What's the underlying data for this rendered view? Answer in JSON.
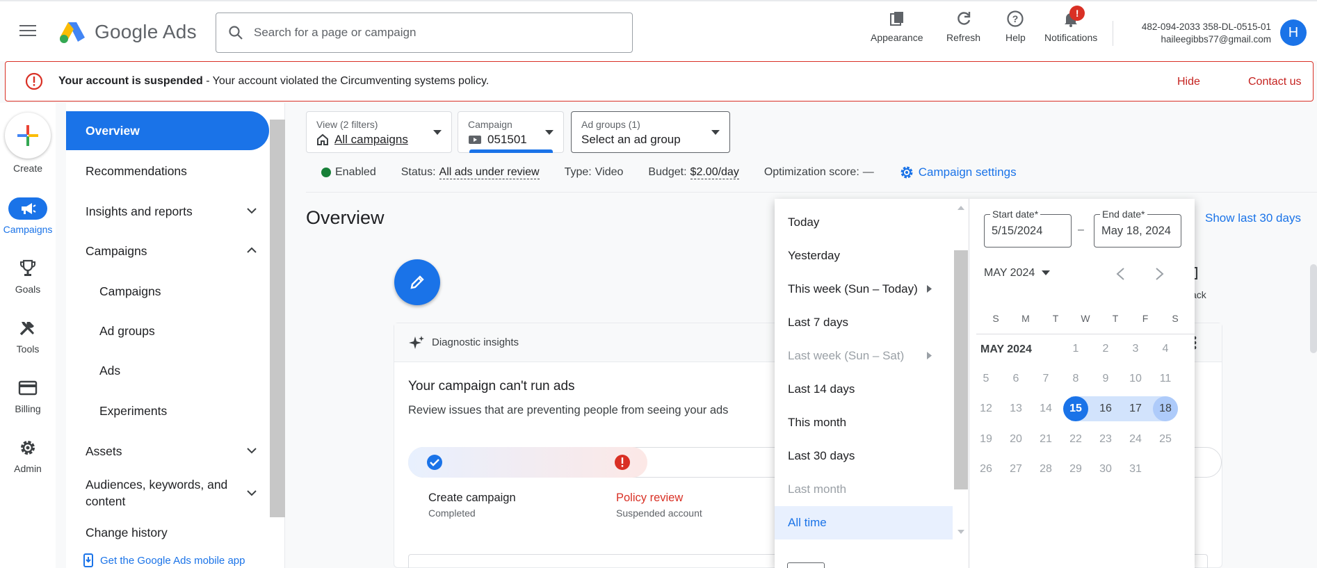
{
  "header": {
    "logo_text": "Google Ads",
    "search_placeholder": "Search for a page or campaign",
    "tools": [
      {
        "label": "Appearance",
        "icon": "appearance-icon"
      },
      {
        "label": "Refresh",
        "icon": "refresh-icon"
      },
      {
        "label": "Help",
        "icon": "help-icon"
      },
      {
        "label": "Notifications",
        "icon": "bell-icon",
        "badge": "!"
      }
    ],
    "account_id": "482-094-2033 358-DL-0515-01",
    "account_email": "haileegibbs77@gmail.com",
    "avatar_letter": "H"
  },
  "alert": {
    "title": "Your account is suspended",
    "message": " - Your account violated the Circumventing systems policy.",
    "hide": "Hide",
    "contact": "Contact us"
  },
  "rail": {
    "create": "Create",
    "items": [
      "Campaigns",
      "Goals",
      "Tools",
      "Billing",
      "Admin"
    ]
  },
  "nav": {
    "items": [
      {
        "label": "Overview"
      },
      {
        "label": "Recommendations"
      },
      {
        "label": "Insights and reports"
      },
      {
        "label": "Campaigns"
      },
      {
        "label": "Campaigns"
      },
      {
        "label": "Ad groups"
      },
      {
        "label": "Ads"
      },
      {
        "label": "Experiments"
      },
      {
        "label": "Assets"
      },
      {
        "label": "Audiences, keywords, and content"
      },
      {
        "label": "Change history"
      }
    ],
    "mobile_app": "Get the Google Ads mobile app"
  },
  "filters": {
    "view_label": "View (2 filters)",
    "view_value": "All campaigns",
    "campaign_label": "Campaign",
    "campaign_value": "051501",
    "adgroup_label": "Ad groups (1)",
    "adgroup_value": "Select an ad group"
  },
  "status": {
    "enabled": "Enabled",
    "status_label": "Status:",
    "status_value": "All ads under review",
    "type_label": "Type:",
    "type_value": "Video",
    "budget_label": "Budget:",
    "budget_value": "$2.00/day",
    "opt_label": "Optimization score:",
    "opt_value": "—",
    "settings": "Campaign settings"
  },
  "main": {
    "title": "Overview",
    "show_last": "Show last 30 days",
    "back_label": "ack"
  },
  "card": {
    "header": "Diagnostic insights",
    "title": "Your campaign can't run ads",
    "desc": "Review issues that are preventing people from seeing your ads",
    "step1_title": "Create campaign",
    "step1_sub": "Completed",
    "step2_title": "Policy review",
    "step2_sub": "Suspended account"
  },
  "datepicker": {
    "ranges": [
      {
        "label": "Today"
      },
      {
        "label": "Yesterday"
      },
      {
        "label": "This week (Sun – Today)"
      },
      {
        "label": "Last 7 days"
      },
      {
        "label": "Last week (Sun – Sat)"
      },
      {
        "label": "Last 14 days"
      },
      {
        "label": "This month"
      },
      {
        "label": "Last 30 days"
      },
      {
        "label": "Last month"
      },
      {
        "label": "All time"
      }
    ],
    "start_label": "Start date*",
    "start_value": "5/15/2024",
    "end_label": "End date*",
    "end_value": "May 18, 2024",
    "dash": "–",
    "month_select": "MAY 2024",
    "month_label": "MAY 2024",
    "weekdays": [
      "S",
      "M",
      "T",
      "W",
      "T",
      "F",
      "S"
    ],
    "days": [
      "1",
      "2",
      "3",
      "4",
      "5",
      "6",
      "7",
      "8",
      "9",
      "10",
      "11",
      "12",
      "13",
      "14",
      "15",
      "16",
      "17",
      "18",
      "19",
      "20",
      "21",
      "22",
      "23",
      "24",
      "25",
      "26",
      "27",
      "28",
      "29",
      "30",
      "31"
    ]
  },
  "colors": {
    "accent": "#1a73e8",
    "error": "#d93025",
    "enabled": "#188038"
  }
}
